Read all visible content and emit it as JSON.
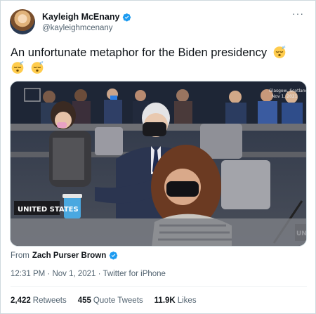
{
  "author": {
    "name": "Kayleigh McEnany",
    "handle": "@kayleighmcenany",
    "verified": true
  },
  "tweet": {
    "text": "An unfortunate metaphor for the Biden presidency",
    "emojis": [
      "sleeping-face",
      "sleeping-face",
      "sleeping-face"
    ]
  },
  "media": {
    "watermark_text": "Glasgow, Scotland\nNov 1, 2021",
    "placard_left": "UNITED STATES",
    "placard_right": "UN"
  },
  "from": {
    "label": "From",
    "name": "Zach Purser Brown"
  },
  "meta": {
    "timestamp": "12:31 PM · Nov 1, 2021 · Twitter for iPhone"
  },
  "stats": {
    "retweets_count": "2,422",
    "retweets_label": "Retweets",
    "quotes_count": "455",
    "quotes_label": "Quote Tweets",
    "likes_count": "11.9K",
    "likes_label": "Likes"
  },
  "colors": {
    "verified": "#1d9bf0",
    "text": "#0f1419",
    "secondary": "#536471",
    "border": "#cfd9de"
  }
}
